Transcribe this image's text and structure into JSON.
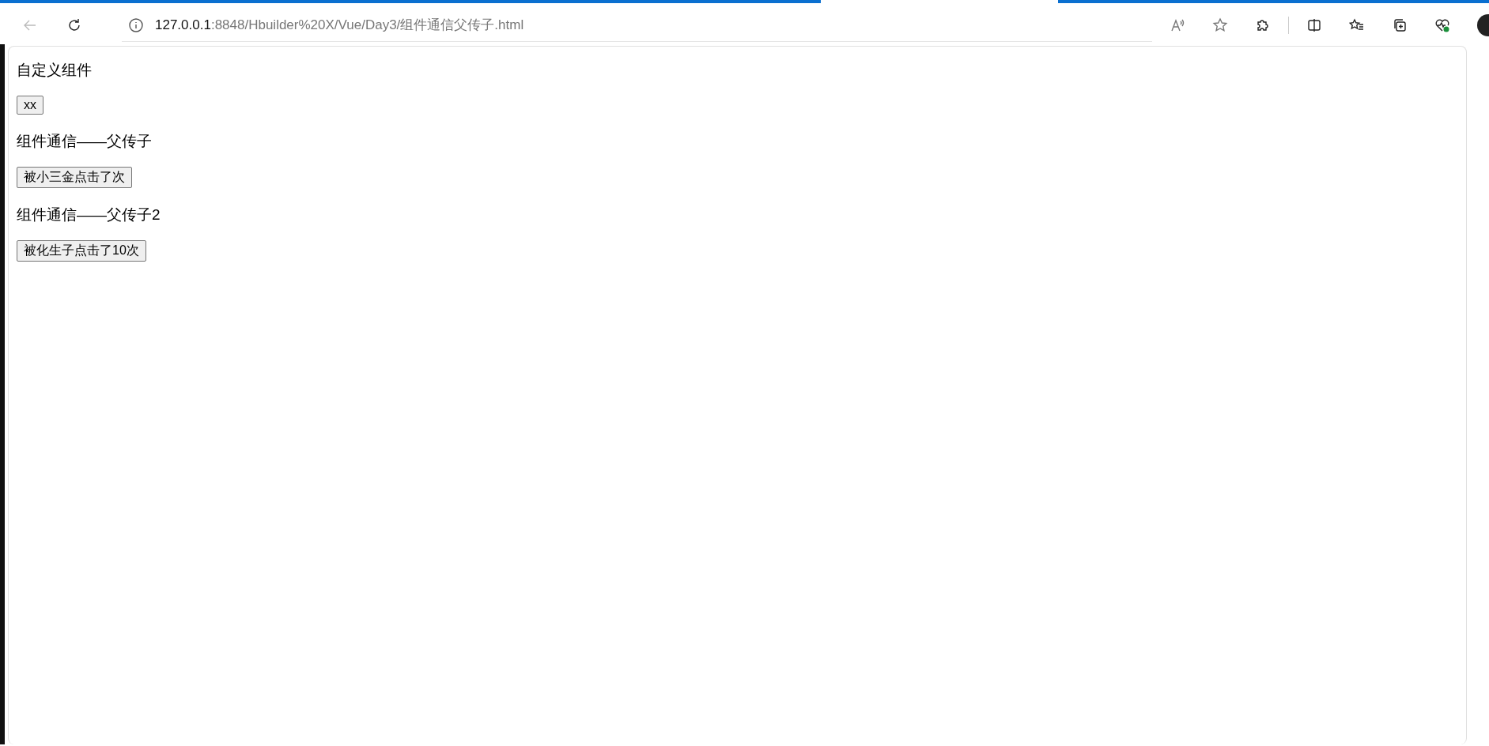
{
  "address_bar": {
    "host": "127.0.0.1",
    "path": ":8848/Hbuilder%20X/Vue/Day3/组件通信父传子.html"
  },
  "content": [
    {
      "kind": "heading",
      "text": "自定义组件"
    },
    {
      "kind": "button",
      "text": "xx"
    },
    {
      "kind": "heading",
      "text": "组件通信——父传子"
    },
    {
      "kind": "button",
      "text": "被小三金点击了次"
    },
    {
      "kind": "heading",
      "text": "组件通信——父传子2"
    },
    {
      "kind": "button",
      "text": "被化生子点击了10次"
    }
  ]
}
